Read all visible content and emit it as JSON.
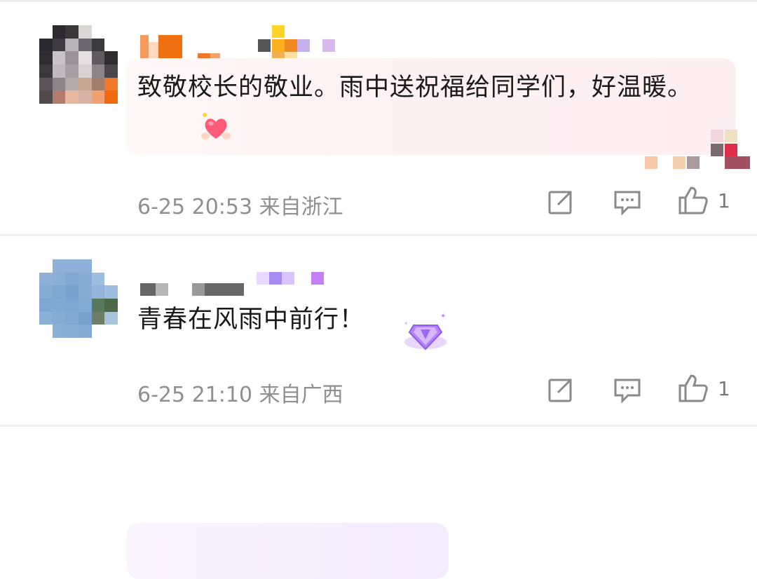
{
  "comments": [
    {
      "text": "致敬校长的敬业。雨中送祝福给同学们，好温暖。",
      "date": "6-25 20:53",
      "location": "来自浙江",
      "like_count": "1",
      "emoji_icon": "heart-in-hands-icon",
      "bubble_colors": {
        "start": "#fff7f8",
        "end": "#fdeef2"
      }
    },
    {
      "text": "青春在风雨中前行！",
      "date": "6-25 21:10",
      "location": "来自广西",
      "like_count": "1",
      "decoration_icon": "purple-gem-icon",
      "bubble_colors": {
        "start": "#faf4ff",
        "end": "#f4ecff"
      }
    }
  ],
  "icons": {
    "share": "share-icon",
    "comment": "comment-icon",
    "like": "thumbs-up-icon"
  }
}
